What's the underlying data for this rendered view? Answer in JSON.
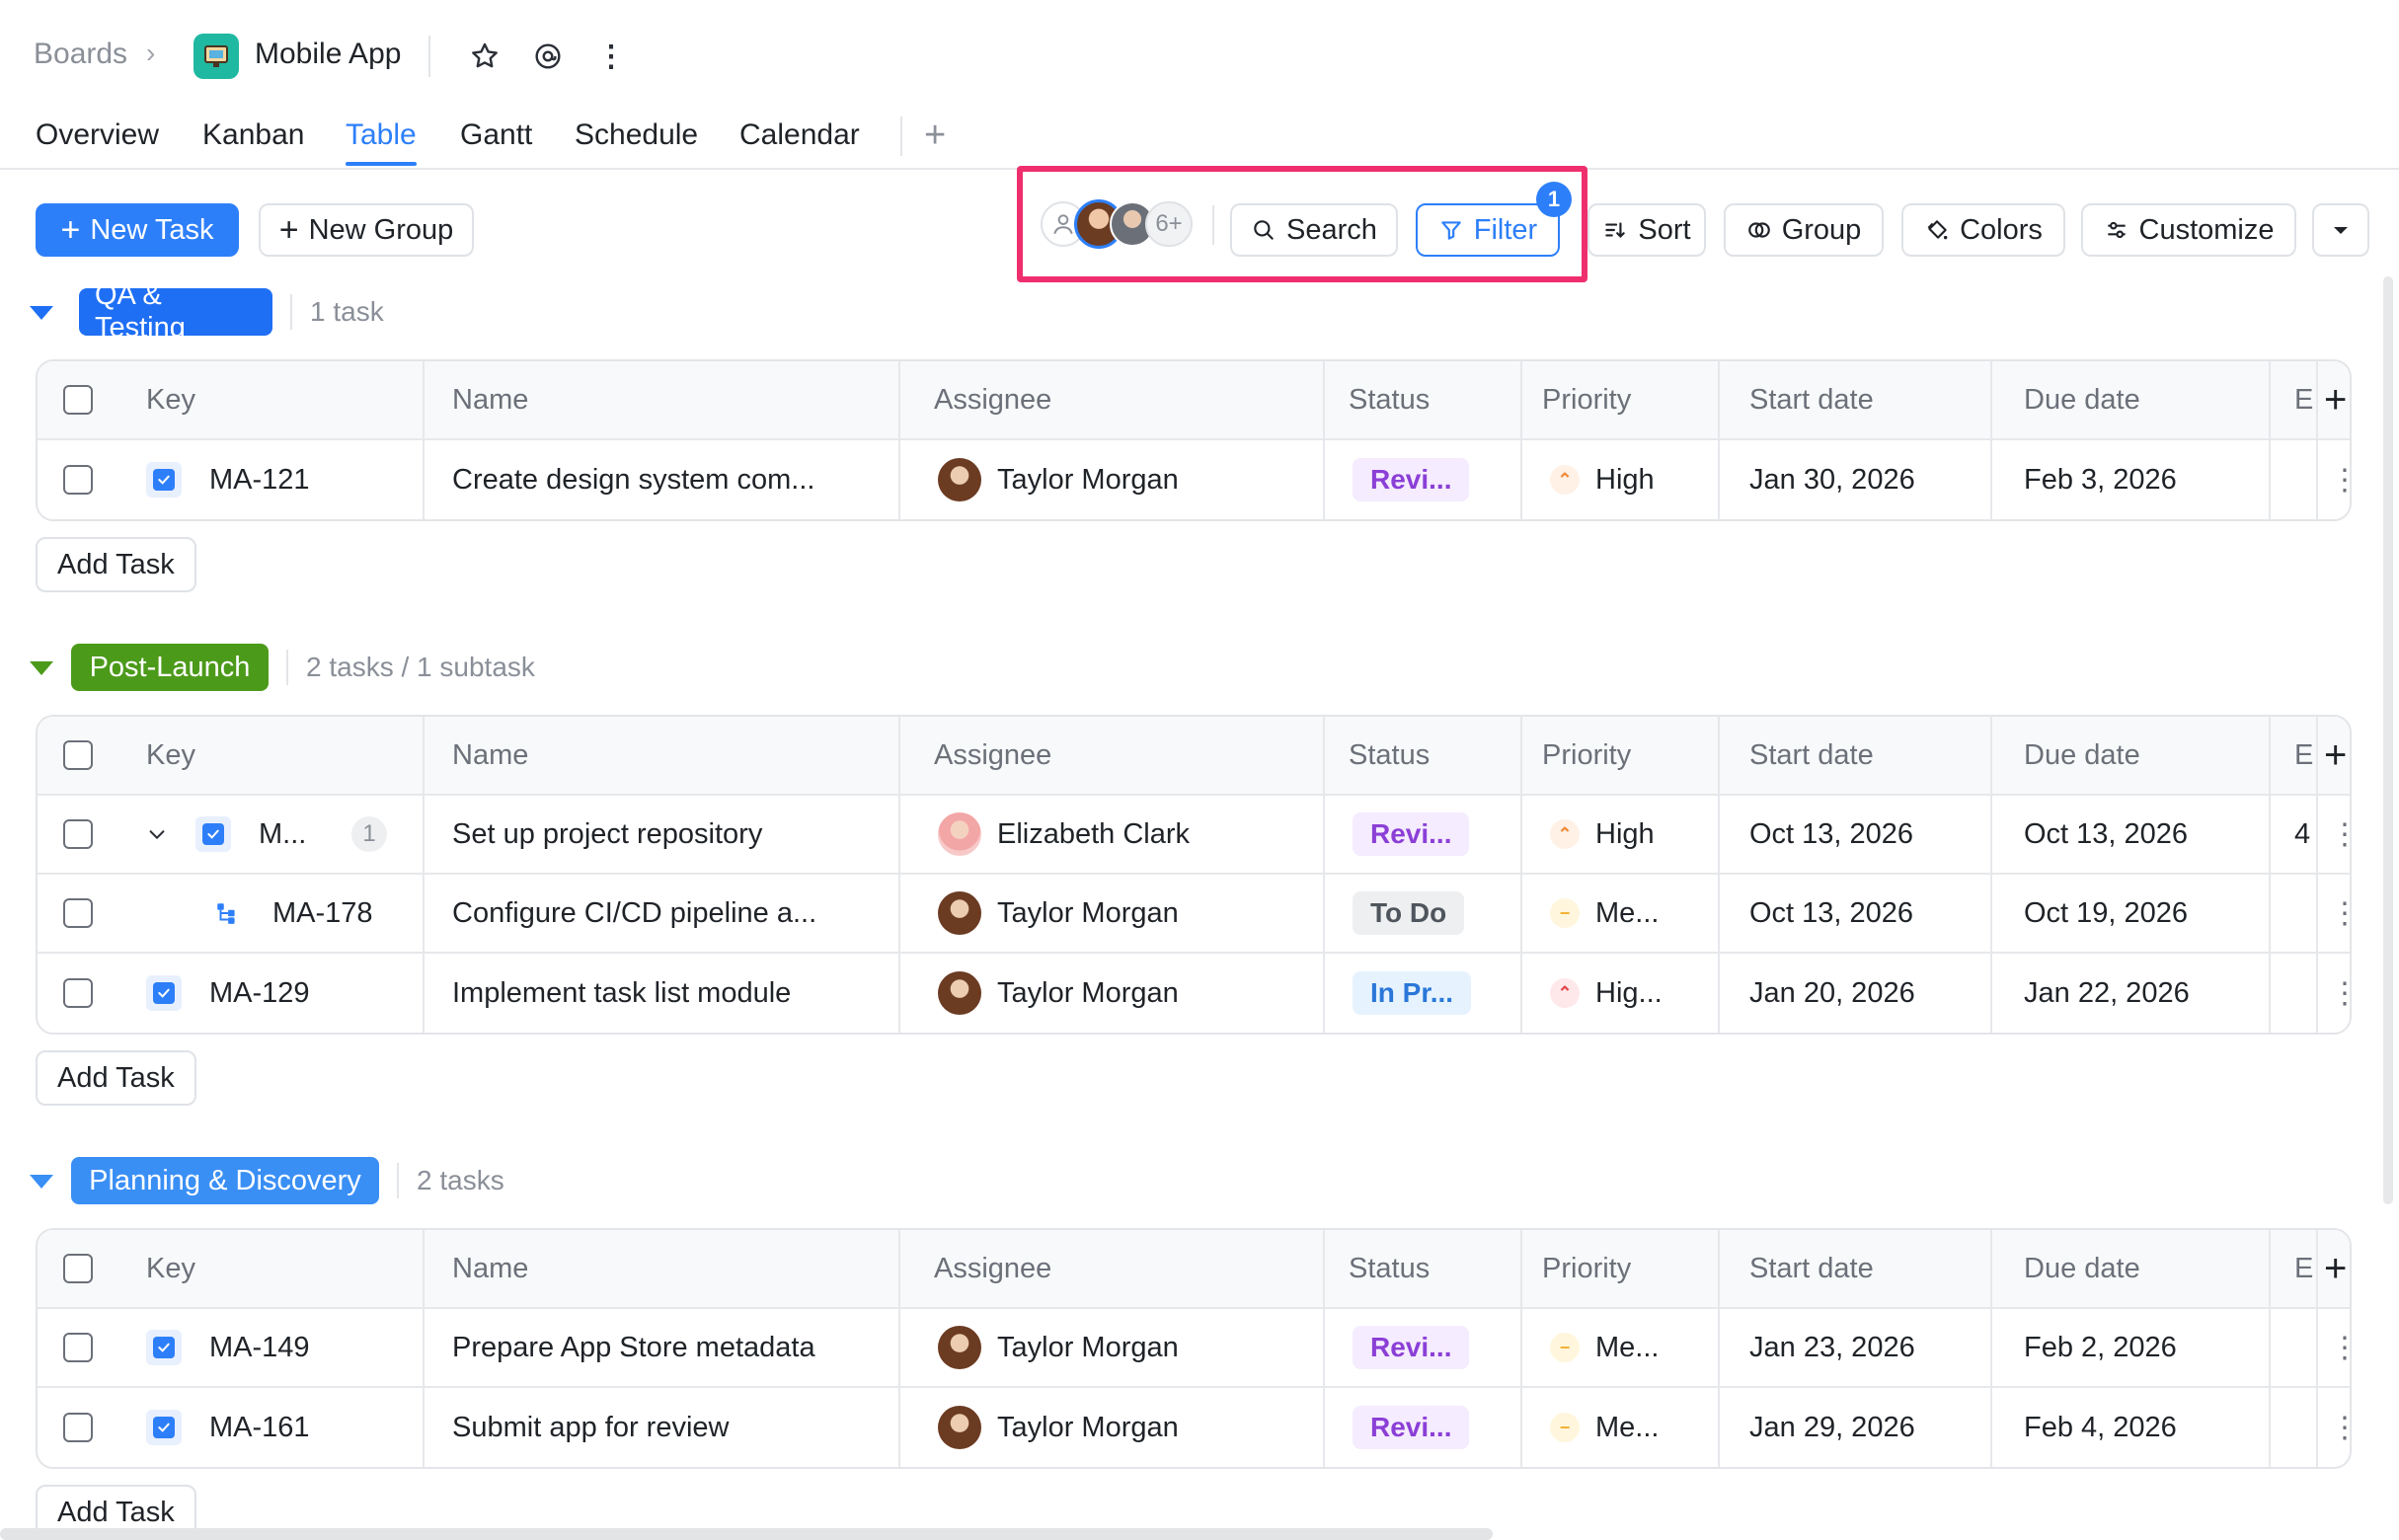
{
  "header": {
    "breadcrumb_root": "Boards",
    "project_name": "Mobile App"
  },
  "tabs": [
    "Overview",
    "Kanban",
    "Table",
    "Gantt",
    "Schedule",
    "Calendar"
  ],
  "toolbar": {
    "new_task": "New Task",
    "new_group": "New Group",
    "assignee_overflow": "6+",
    "search": "Search",
    "filter": "Filter",
    "filter_count": "1",
    "sort": "Sort",
    "group": "Group",
    "colors": "Colors",
    "customize": "Customize"
  },
  "columns": [
    "Key",
    "Name",
    "Assignee",
    "Status",
    "Priority",
    "Start date",
    "Due date",
    "E"
  ],
  "add_task_label": "Add Task",
  "groups": [
    {
      "name": "QA & Testing",
      "count": "1 task",
      "color": "#1f6ff5",
      "rows": [
        {
          "key": "MA-121",
          "name": "Create design system com...",
          "assignee": "Taylor Morgan",
          "status": "Revi...",
          "status_type": "review",
          "priority": "High",
          "priority_level": "high",
          "start": "Jan 30, 2026",
          "due": "Feb 3, 2026",
          "extra": ""
        }
      ]
    },
    {
      "name": "Post-Launch",
      "count": "2 tasks / 1 subtask",
      "color": "#4c9a1a",
      "rows": [
        {
          "key": "M...",
          "sub_count": "1",
          "name": "Set up project repository",
          "assignee": "Elizabeth Clark",
          "status": "Revi...",
          "status_type": "review",
          "priority": "High",
          "priority_level": "high",
          "start": "Oct 13, 2026",
          "due": "Oct 13, 2026",
          "extra": "4"
        },
        {
          "key": "MA-178",
          "name": "Configure CI/CD pipeline a...",
          "assignee": "Taylor Morgan",
          "status": "To Do",
          "status_type": "todo",
          "priority": "Me...",
          "priority_level": "medium",
          "start": "Oct 13, 2026",
          "due": "Oct 19, 2026",
          "extra": ""
        },
        {
          "key": "MA-129",
          "name": "Implement task list module",
          "assignee": "Taylor Morgan",
          "status": "In Pr...",
          "status_type": "progress",
          "priority": "Hig...",
          "priority_level": "highest",
          "start": "Jan 20, 2026",
          "due": "Jan 22, 2026",
          "extra": ""
        }
      ]
    },
    {
      "name": "Planning & Discovery",
      "count": "2 tasks",
      "color": "#3a8ff5",
      "rows": [
        {
          "key": "MA-149",
          "name": "Prepare App Store metadata",
          "assignee": "Taylor Morgan",
          "status": "Revi...",
          "status_type": "review",
          "priority": "Me...",
          "priority_level": "medium",
          "start": "Jan 23, 2026",
          "due": "Feb 2, 2026",
          "extra": ""
        },
        {
          "key": "MA-161",
          "name": "Submit app for review",
          "assignee": "Taylor Morgan",
          "status": "Revi...",
          "status_type": "review",
          "priority": "Me...",
          "priority_level": "medium",
          "start": "Jan 29, 2026",
          "due": "Feb 4, 2026",
          "extra": ""
        }
      ]
    }
  ]
}
